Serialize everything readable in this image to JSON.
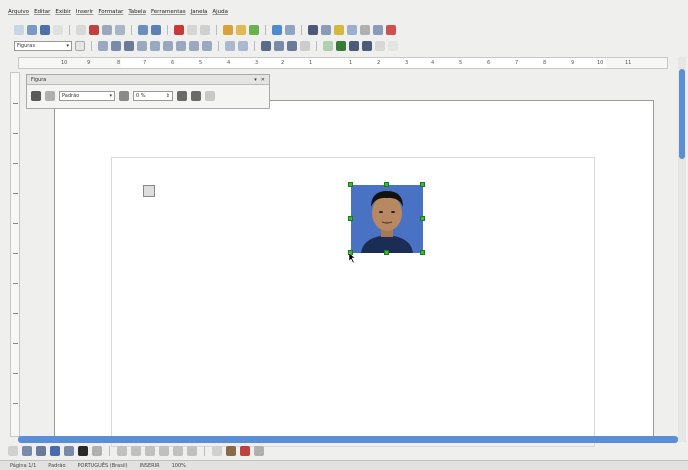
{
  "menu": [
    "Arquivo",
    "Editar",
    "Exibir",
    "Inserir",
    "Formatar",
    "Tabela",
    "Ferramentas",
    "Janela",
    "Ajuda"
  ],
  "toolbar": {
    "style_value": "Figuras"
  },
  "ruler": {
    "ticks": [
      "10",
      "9",
      "8",
      "7",
      "6",
      "5",
      "4",
      "3",
      "2",
      "1",
      "1",
      "2",
      "3",
      "4",
      "5",
      "6",
      "7",
      "8",
      "9",
      "10",
      "11"
    ]
  },
  "picture_panel": {
    "title": "Figura",
    "mode_value": "Padrão",
    "transparency_value": "0 %"
  },
  "status": {
    "page": "Página 1/1",
    "style": "Padrão",
    "language": "PORTUGUÊS (Brasil)",
    "zoom": "100%",
    "insert_mode": "INSERIR"
  },
  "colors": {
    "accent": "#5a8fd8",
    "handle": "#3fb43f",
    "photo_bg": "#4a72c4"
  }
}
